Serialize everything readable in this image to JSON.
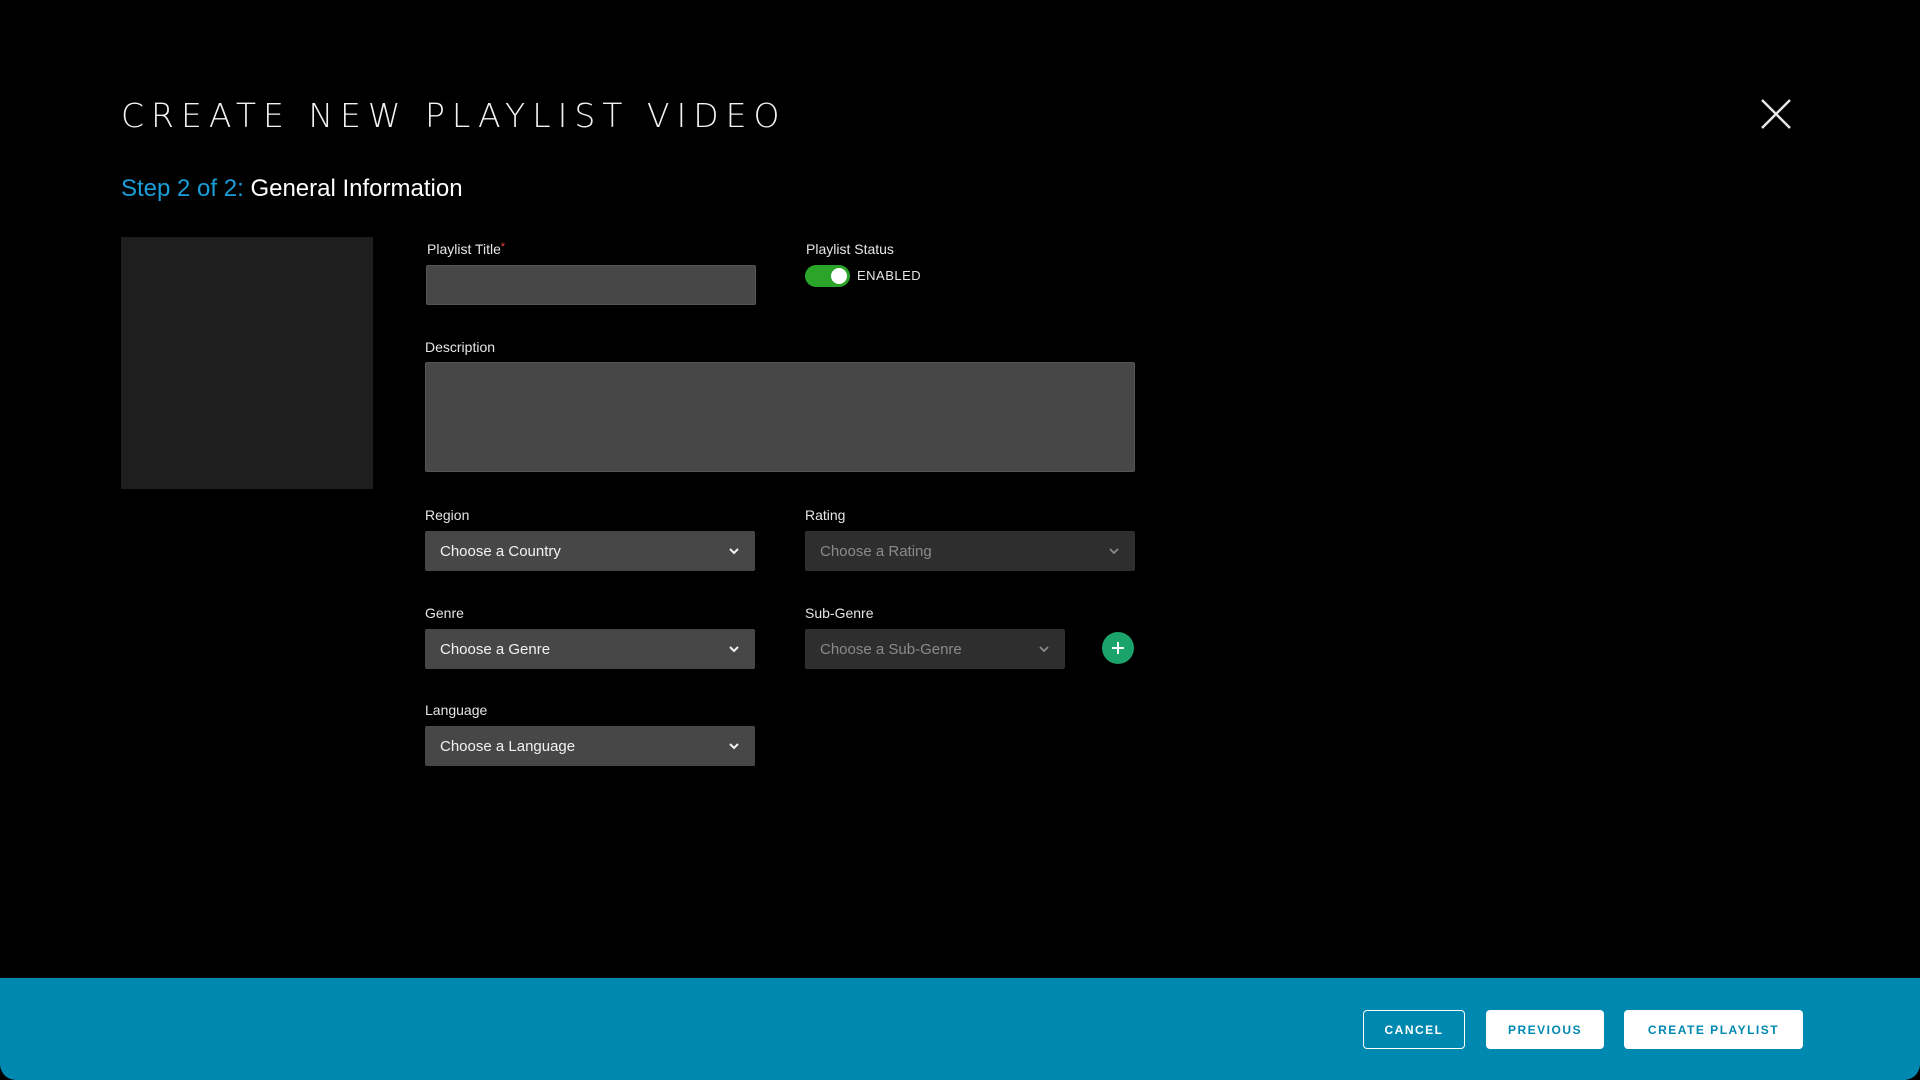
{
  "header": {
    "title": "CREATE NEW PLAYLIST VIDEO",
    "step_prefix": "Step 2 of 2:",
    "step_name": "General Information"
  },
  "form": {
    "title_label": "Playlist Title",
    "required_mark": "*",
    "title_value": "",
    "status_label": "Playlist Status",
    "status_text": "ENABLED",
    "status_on": true,
    "description_label": "Description",
    "description_value": "",
    "region_label": "Region",
    "region_value": "Choose a Country",
    "rating_label": "Rating",
    "rating_value": "Choose a Rating",
    "genre_label": "Genre",
    "genre_value": "Choose a Genre",
    "subgenre_label": "Sub-Genre",
    "subgenre_value": "Choose a Sub-Genre",
    "language_label": "Language",
    "language_value": "Choose a Language"
  },
  "footer": {
    "cancel": "CANCEL",
    "previous": "PREVIOUS",
    "create": "CREATE PLAYLIST"
  },
  "icons": {
    "close": "close-icon",
    "chevron": "chevron-down-icon",
    "add": "plus-icon"
  },
  "colors": {
    "accent": "#1a9ed9",
    "footer": "#0089b0",
    "toggle_on": "#2aa52a",
    "add_button": "#1aa36b",
    "required": "#e0453a"
  }
}
